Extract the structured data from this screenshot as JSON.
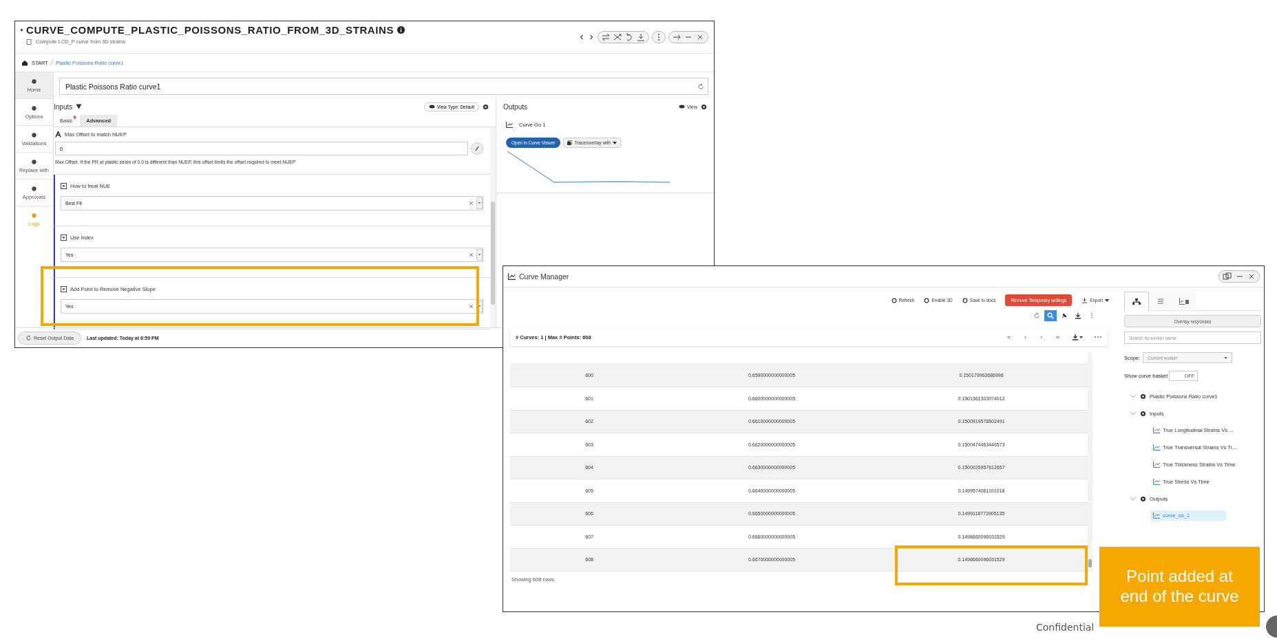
{
  "process_window": {
    "title": "CURVE_COMPUTE_PLASTIC_POISSONS_RATIO_FROM_3D_STRAINS",
    "subtitle": "Compute LCD_P curve from 3D strains",
    "breadcrumb": [
      "START",
      "Plastic Poissons Ratio curve1"
    ],
    "nav": [
      {
        "label": "Home",
        "selected": true,
        "highlighted": false
      },
      {
        "label": "Options",
        "selected": false,
        "highlighted": false
      },
      {
        "label": "Validations",
        "selected": false,
        "highlighted": false
      },
      {
        "label": "Replace with",
        "selected": false,
        "highlighted": false
      },
      {
        "label": "Approvals",
        "selected": false,
        "highlighted": false
      },
      {
        "label": "Logs",
        "selected": false,
        "highlighted": true
      }
    ],
    "name_value": "Plastic Poissons Ratio curve1",
    "inputs": {
      "title": "Inputs",
      "view_type": "View Type: Default",
      "tabs": [
        {
          "label": "Basic",
          "selected": false,
          "required": true
        },
        {
          "label": "Advanced",
          "selected": true,
          "required": false
        }
      ],
      "fields": [
        {
          "kind": "text",
          "label": "Max Offset to match NUEP",
          "value": "0",
          "help": "Max Offset. If the PR at plastic strain of 0.0 is different than NUEP, this offset limits the offset required to meet NUEP"
        },
        {
          "kind": "select",
          "label": "How to treat NUE",
          "value": "Best Fit"
        },
        {
          "kind": "select",
          "label": "Use Index",
          "value": "Yes"
        },
        {
          "kind": "select",
          "label": "Add Point to Remove Negative Slope",
          "value": "Yes"
        }
      ]
    },
    "outputs": {
      "title": "Outputs",
      "view": "View",
      "curve_name": "Curve Oo 1",
      "open_button": "Open in Curve Viewer",
      "trace_button": "Trace/overlay with"
    },
    "reset_button": "Reset Output Data",
    "last_updated": "Last updated: Today at 6:59 PM"
  },
  "curve_manager": {
    "title": "Curve Manager",
    "toolbar": [
      "Refresh",
      "Enable 3D",
      "Save to docs"
    ],
    "remove_button": "Remove Temporary settings",
    "export_button": "Export",
    "tools": [
      {
        "kind": "reload",
        "selected": false
      },
      {
        "kind": "search",
        "selected": true
      },
      {
        "kind": "pin",
        "selected": false
      },
      {
        "kind": "download",
        "selected": false
      },
      {
        "kind": "more",
        "selected": false
      }
    ],
    "summary": "# Curves: 1 | Max # Points: 608",
    "pager": [
      "«",
      "‹",
      "›",
      "»"
    ],
    "rows": [
      [
        "600",
        "0.6590000000000005",
        "0.150179963686996"
      ],
      [
        "601",
        "0.6600000000000005",
        "0.1501361303074012"
      ],
      [
        "602",
        "0.6610000000000005",
        "0.1500919578602491"
      ],
      [
        "603",
        "0.6620000000000005",
        "0.1500474463446573"
      ],
      [
        "604",
        "0.6630000000000005",
        "0.1500025957612657"
      ],
      [
        "605",
        "0.6640000000000005",
        "0.1499574061101018"
      ],
      [
        "606",
        "0.6650000000000005",
        "0.1499118773905135"
      ],
      [
        "607",
        "0.6660000000000005",
        "0.1498660096031529"
      ],
      [
        "608",
        "0.6670000000000005",
        "0.1498660096031529"
      ]
    ],
    "footer": "Showing 608 rows.",
    "sidebar": {
      "tabs": [
        {
          "kind": "hierarchy",
          "selected": true
        },
        {
          "kind": "list",
          "selected": false
        },
        {
          "kind": "chart-save",
          "selected": false
        }
      ],
      "overlay_button": "Overlay responses",
      "search_placeholder": "Search by worker name",
      "scope_label": "Scope:",
      "scope_value": "Current worker",
      "basket_label": "Show curve basket",
      "basket_toggle": {
        "label": "OFF",
        "on": false
      },
      "tree": [
        {
          "label": "Plastic Poissons Ratio curve1",
          "kind": "group",
          "expanded": true,
          "selected": false,
          "children": [
            {
              "label": "Inputs",
              "kind": "group",
              "expanded": true,
              "selected": false,
              "children": [
                {
                  "label": "True Longitudinal Strains Vs ...",
                  "kind": "curve",
                  "selected": false
                },
                {
                  "label": "True Transversal Strains Vs Ti...",
                  "kind": "curve",
                  "selected": false
                },
                {
                  "label": "True Thickness Strains Vs Time",
                  "kind": "curve",
                  "selected": false
                },
                {
                  "label": "True Stress Vs Time",
                  "kind": "curve",
                  "selected": false
                }
              ]
            },
            {
              "label": "Outputs",
              "kind": "group",
              "expanded": true,
              "selected": false,
              "children": [
                {
                  "label": "curve_oo_1",
                  "kind": "curve",
                  "selected": true
                }
              ]
            }
          ]
        }
      ]
    }
  },
  "annotations": {
    "callout": "Point added at end of the curve",
    "footer": "Confidential"
  }
}
